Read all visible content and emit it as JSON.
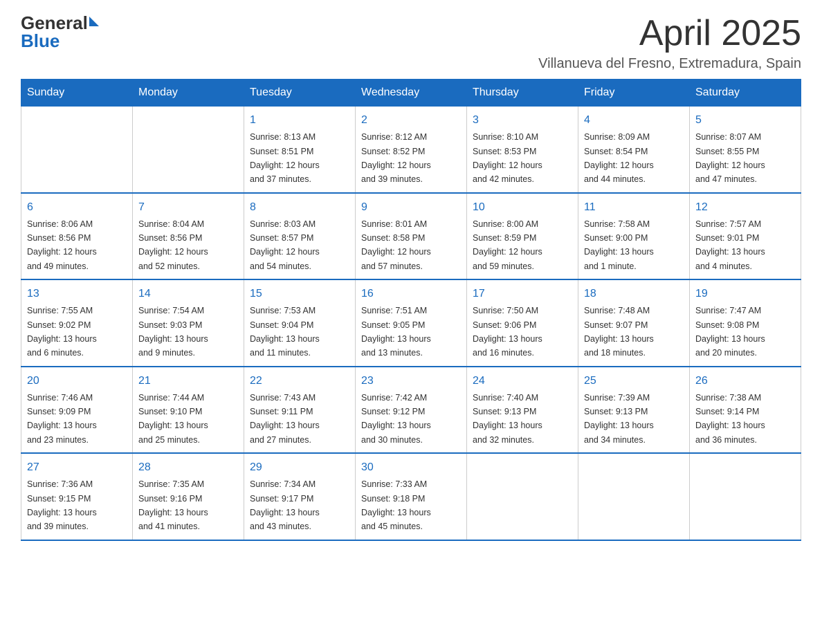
{
  "header": {
    "logo_general": "General",
    "logo_blue": "Blue",
    "month_title": "April 2025",
    "subtitle": "Villanueva del Fresno, Extremadura, Spain"
  },
  "columns": [
    "Sunday",
    "Monday",
    "Tuesday",
    "Wednesday",
    "Thursday",
    "Friday",
    "Saturday"
  ],
  "weeks": [
    [
      {
        "day": "",
        "info": ""
      },
      {
        "day": "",
        "info": ""
      },
      {
        "day": "1",
        "info": "Sunrise: 8:13 AM\nSunset: 8:51 PM\nDaylight: 12 hours\nand 37 minutes."
      },
      {
        "day": "2",
        "info": "Sunrise: 8:12 AM\nSunset: 8:52 PM\nDaylight: 12 hours\nand 39 minutes."
      },
      {
        "day": "3",
        "info": "Sunrise: 8:10 AM\nSunset: 8:53 PM\nDaylight: 12 hours\nand 42 minutes."
      },
      {
        "day": "4",
        "info": "Sunrise: 8:09 AM\nSunset: 8:54 PM\nDaylight: 12 hours\nand 44 minutes."
      },
      {
        "day": "5",
        "info": "Sunrise: 8:07 AM\nSunset: 8:55 PM\nDaylight: 12 hours\nand 47 minutes."
      }
    ],
    [
      {
        "day": "6",
        "info": "Sunrise: 8:06 AM\nSunset: 8:56 PM\nDaylight: 12 hours\nand 49 minutes."
      },
      {
        "day": "7",
        "info": "Sunrise: 8:04 AM\nSunset: 8:56 PM\nDaylight: 12 hours\nand 52 minutes."
      },
      {
        "day": "8",
        "info": "Sunrise: 8:03 AM\nSunset: 8:57 PM\nDaylight: 12 hours\nand 54 minutes."
      },
      {
        "day": "9",
        "info": "Sunrise: 8:01 AM\nSunset: 8:58 PM\nDaylight: 12 hours\nand 57 minutes."
      },
      {
        "day": "10",
        "info": "Sunrise: 8:00 AM\nSunset: 8:59 PM\nDaylight: 12 hours\nand 59 minutes."
      },
      {
        "day": "11",
        "info": "Sunrise: 7:58 AM\nSunset: 9:00 PM\nDaylight: 13 hours\nand 1 minute."
      },
      {
        "day": "12",
        "info": "Sunrise: 7:57 AM\nSunset: 9:01 PM\nDaylight: 13 hours\nand 4 minutes."
      }
    ],
    [
      {
        "day": "13",
        "info": "Sunrise: 7:55 AM\nSunset: 9:02 PM\nDaylight: 13 hours\nand 6 minutes."
      },
      {
        "day": "14",
        "info": "Sunrise: 7:54 AM\nSunset: 9:03 PM\nDaylight: 13 hours\nand 9 minutes."
      },
      {
        "day": "15",
        "info": "Sunrise: 7:53 AM\nSunset: 9:04 PM\nDaylight: 13 hours\nand 11 minutes."
      },
      {
        "day": "16",
        "info": "Sunrise: 7:51 AM\nSunset: 9:05 PM\nDaylight: 13 hours\nand 13 minutes."
      },
      {
        "day": "17",
        "info": "Sunrise: 7:50 AM\nSunset: 9:06 PM\nDaylight: 13 hours\nand 16 minutes."
      },
      {
        "day": "18",
        "info": "Sunrise: 7:48 AM\nSunset: 9:07 PM\nDaylight: 13 hours\nand 18 minutes."
      },
      {
        "day": "19",
        "info": "Sunrise: 7:47 AM\nSunset: 9:08 PM\nDaylight: 13 hours\nand 20 minutes."
      }
    ],
    [
      {
        "day": "20",
        "info": "Sunrise: 7:46 AM\nSunset: 9:09 PM\nDaylight: 13 hours\nand 23 minutes."
      },
      {
        "day": "21",
        "info": "Sunrise: 7:44 AM\nSunset: 9:10 PM\nDaylight: 13 hours\nand 25 minutes."
      },
      {
        "day": "22",
        "info": "Sunrise: 7:43 AM\nSunset: 9:11 PM\nDaylight: 13 hours\nand 27 minutes."
      },
      {
        "day": "23",
        "info": "Sunrise: 7:42 AM\nSunset: 9:12 PM\nDaylight: 13 hours\nand 30 minutes."
      },
      {
        "day": "24",
        "info": "Sunrise: 7:40 AM\nSunset: 9:13 PM\nDaylight: 13 hours\nand 32 minutes."
      },
      {
        "day": "25",
        "info": "Sunrise: 7:39 AM\nSunset: 9:13 PM\nDaylight: 13 hours\nand 34 minutes."
      },
      {
        "day": "26",
        "info": "Sunrise: 7:38 AM\nSunset: 9:14 PM\nDaylight: 13 hours\nand 36 minutes."
      }
    ],
    [
      {
        "day": "27",
        "info": "Sunrise: 7:36 AM\nSunset: 9:15 PM\nDaylight: 13 hours\nand 39 minutes."
      },
      {
        "day": "28",
        "info": "Sunrise: 7:35 AM\nSunset: 9:16 PM\nDaylight: 13 hours\nand 41 minutes."
      },
      {
        "day": "29",
        "info": "Sunrise: 7:34 AM\nSunset: 9:17 PM\nDaylight: 13 hours\nand 43 minutes."
      },
      {
        "day": "30",
        "info": "Sunrise: 7:33 AM\nSunset: 9:18 PM\nDaylight: 13 hours\nand 45 minutes."
      },
      {
        "day": "",
        "info": ""
      },
      {
        "day": "",
        "info": ""
      },
      {
        "day": "",
        "info": ""
      }
    ]
  ]
}
